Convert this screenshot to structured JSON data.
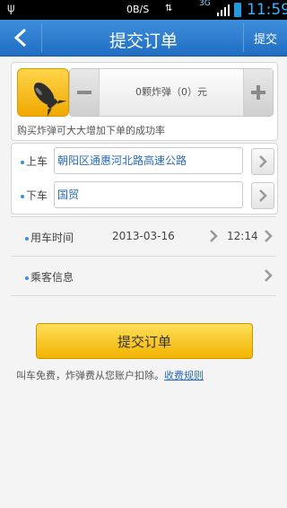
{
  "status_bar": {
    "speed": "0B/S",
    "network": "3G",
    "time": "11:59"
  },
  "header": {
    "title": "提交订单",
    "submit_label": "提交"
  },
  "bomb": {
    "count_text": "0颗炸弹（0）元",
    "hint": "购买炸弹可大大增加下单的成功率"
  },
  "route": {
    "pickup_label": "上车",
    "pickup_value": "朝阳区通惠河北路高速公路",
    "dropoff_label": "下车",
    "dropoff_value": "国贸"
  },
  "time_row": {
    "label": "用车时间",
    "date": "2013-03-16",
    "time": "12:14"
  },
  "passenger_row": {
    "label": "乘客信息"
  },
  "submit_button": "提交订单",
  "footnote": {
    "text": "叫车免费，炸弹费从您账户扣除。",
    "link": "收费规则"
  },
  "colors": {
    "header_blue": "#2a7dd0",
    "accent_blue": "#2a6bb8",
    "button_yellow": "#f6c21e"
  }
}
